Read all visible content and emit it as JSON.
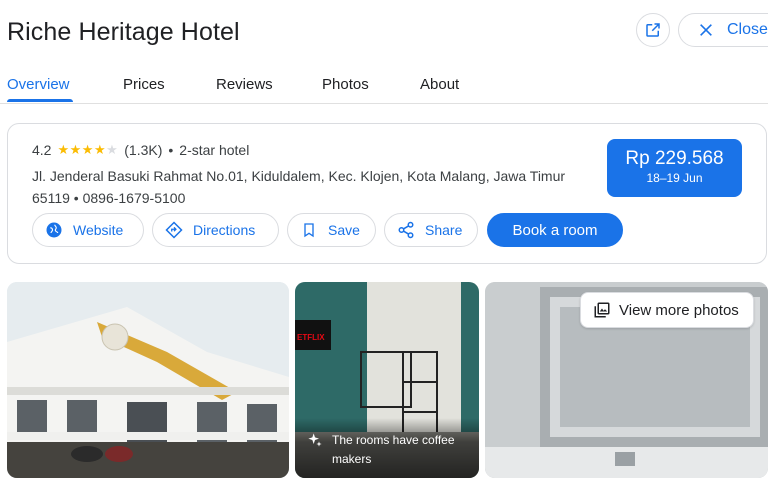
{
  "hotel": {
    "name": "Riche Heritage Hotel",
    "rating": "4.2",
    "stars_filled": 4,
    "review_count": "(1.3K)",
    "separator": "•",
    "category": "2-star hotel",
    "address": "Jl. Jenderal Basuki Rahmat No.01, Kiduldalem, Kec. Klojen, Kota Malang, Jawa Timur 65119",
    "phone": "0896-1679-5100"
  },
  "header": {
    "close_label": "Close"
  },
  "tabs": [
    {
      "label": "Overview",
      "active": true
    },
    {
      "label": "Prices",
      "active": false
    },
    {
      "label": "Reviews",
      "active": false
    },
    {
      "label": "Photos",
      "active": false
    },
    {
      "label": "About",
      "active": false
    }
  ],
  "price": {
    "amount": "Rp 229.568",
    "dates": "18–19 Jun"
  },
  "actions": {
    "website": "Website",
    "directions": "Directions",
    "save": "Save",
    "share": "Share",
    "book": "Book a room"
  },
  "photos": {
    "caption": "The rooms have coffee makers",
    "view_more": "View more photos"
  },
  "colors": {
    "accent": "#1a73e8",
    "star": "#fbbc04",
    "border": "#dadce0"
  },
  "icons": [
    "open-in-new-icon",
    "close-icon",
    "globe-icon",
    "directions-icon",
    "bookmark-icon",
    "share-icon",
    "sparkle-icon",
    "photo-library-icon",
    "star-icon"
  ]
}
